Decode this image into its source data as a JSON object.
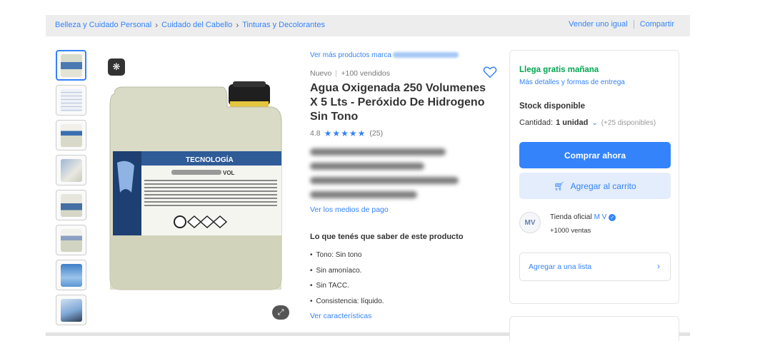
{
  "breadcrumb": {
    "items": [
      "Belleza y Cuidado Personal",
      "Cuidado del Cabello",
      "Tinturas y Decolorantes"
    ],
    "actions": [
      "Vender uno igual",
      "Compartir"
    ]
  },
  "gallery": {
    "thumbnails": [
      "thumb-1",
      "thumb-2",
      "thumb-3",
      "thumb-4",
      "thumb-5",
      "thumb-6",
      "thumb-7",
      "thumb-8"
    ],
    "badge_icon": "rotate-360-icon",
    "zoom_icon": "expand-icon",
    "label_text": "VOL"
  },
  "product": {
    "brand_link": "Ver más productos marca",
    "condition": "Nuevo",
    "sold": "+100 vendidos",
    "title": "Agua Oxigenada 250 Volumenes X 5 Lts - Peróxido De Hidrogeno Sin Tono",
    "rating_value": "4.8",
    "stars": "★★★★★",
    "reviews": "(25)",
    "payment_link": "Ver los medios de pago",
    "know_title": "Lo que tenés que saber de este producto",
    "features": [
      "Tono: Sin tono",
      "Sin amoníaco.",
      "Sin TACC.",
      "Consistencia: líquido."
    ],
    "characteristics_link": "Ver características"
  },
  "buybox": {
    "shipping": "Llega gratis mañana",
    "shipping_more": "Más detalles y formas de entrega",
    "stock": "Stock disponible",
    "quantity_label": "Cantidad:",
    "quantity_value": "1 unidad",
    "available": "(+25 disponibles)",
    "buy_button": "Comprar ahora",
    "cart_button": "Agregar al carrito",
    "store_prefix": "Tienda oficial",
    "store_name": "M V",
    "store_sales": "+1000 ventas",
    "add_list": "Agregar a una lista"
  },
  "colors": {
    "accent": "#3483fa",
    "success": "#00a650",
    "breadcrumb_bg": "#ededed"
  }
}
